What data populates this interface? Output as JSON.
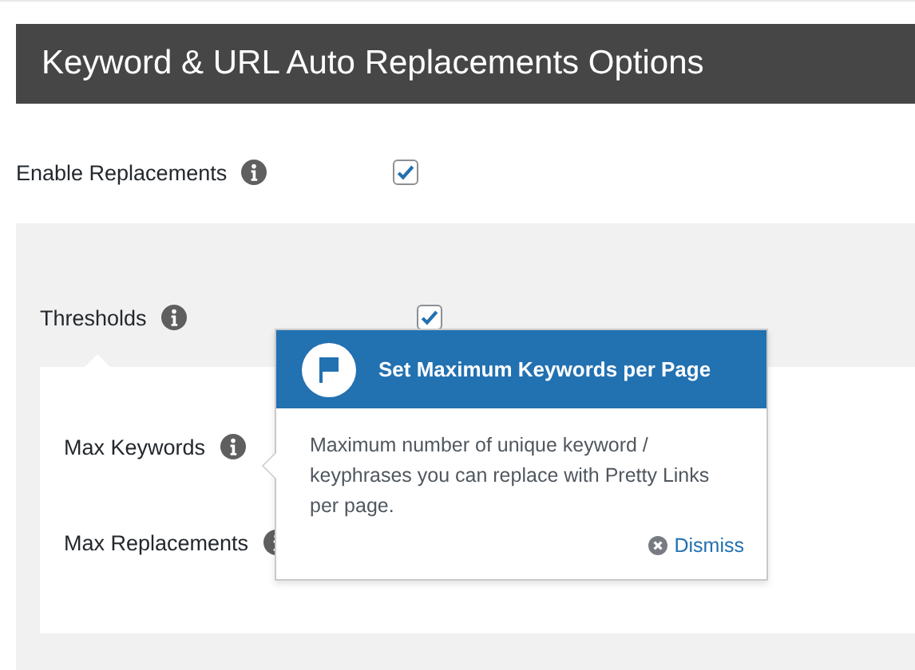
{
  "heading": "Keyword & URL Auto Replacements Options",
  "enable": {
    "label": "Enable Replacements",
    "checked": true
  },
  "thresholds": {
    "label": "Thresholds",
    "checked": true,
    "fields": [
      {
        "label": "Max Keywords"
      },
      {
        "label": "Max Replacements"
      }
    ]
  },
  "tooltip": {
    "title": "Set Maximum Keywords per Page",
    "body": "Maximum number of unique keyword / keyphrases you can replace with Pretty Links per page.",
    "dismiss": "Dismiss"
  }
}
